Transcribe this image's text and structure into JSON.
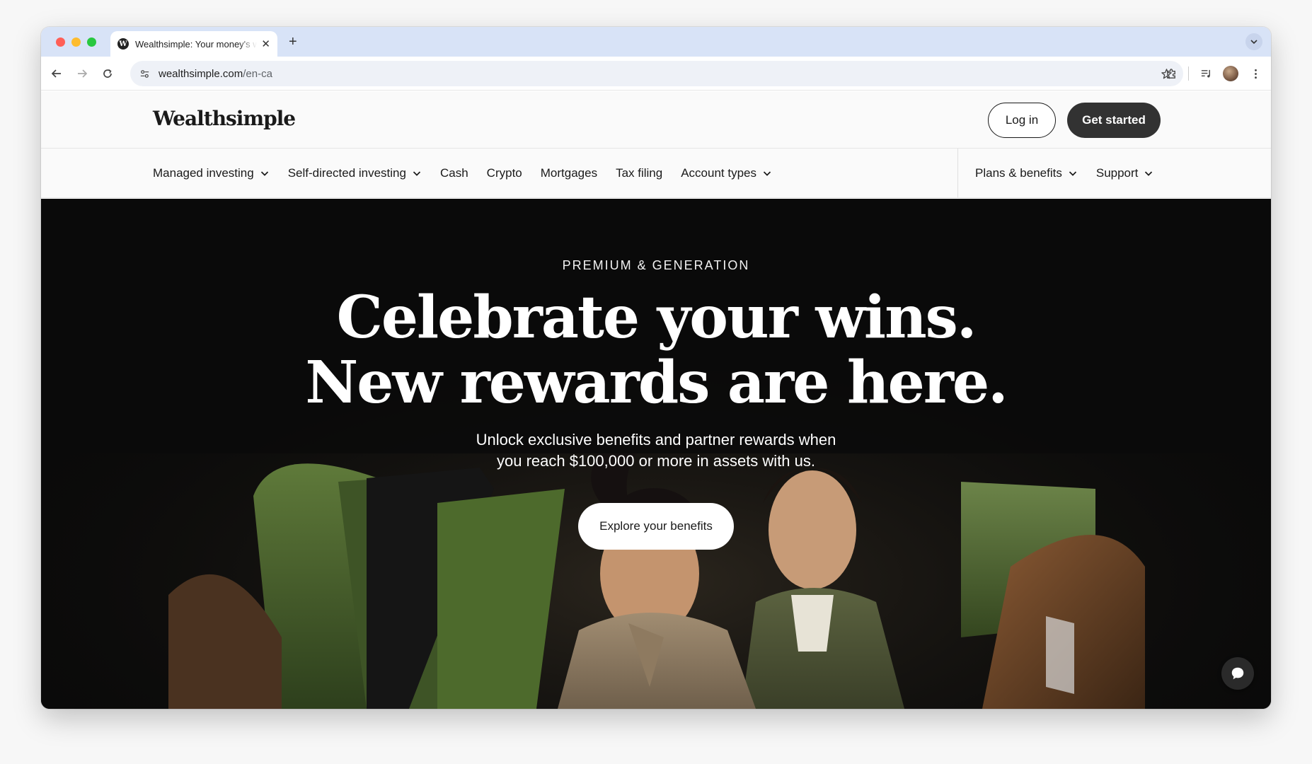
{
  "browser": {
    "tab_title": "Wealthsimple: Your money's working for you",
    "tab_favicon_letter": "W",
    "new_tab_symbol": "+",
    "close_symbol": "✕",
    "url_host": "wealthsimple.com",
    "url_path": "/en-ca"
  },
  "header": {
    "logo": "Wealthsimple",
    "login_label": "Log in",
    "get_started_label": "Get started"
  },
  "nav": {
    "left_items": [
      {
        "label": "Managed investing",
        "dropdown": true
      },
      {
        "label": "Self-directed investing",
        "dropdown": true
      },
      {
        "label": "Cash",
        "dropdown": false
      },
      {
        "label": "Crypto",
        "dropdown": false
      },
      {
        "label": "Mortgages",
        "dropdown": false
      },
      {
        "label": "Tax filing",
        "dropdown": false
      },
      {
        "label": "Account types",
        "dropdown": true
      }
    ],
    "right_items": [
      {
        "label": "Plans & benefits",
        "dropdown": true
      },
      {
        "label": "Support",
        "dropdown": true
      }
    ]
  },
  "hero": {
    "eyebrow": "PREMIUM & GENERATION",
    "headline_line1": "Celebrate your wins.",
    "headline_line2": "New rewards are here.",
    "sub_line1": "Unlock exclusive benefits and partner rewards when",
    "sub_line2": "you reach $100,000 or more in assets with us.",
    "cta_label": "Explore your benefits"
  },
  "colors": {
    "tab_strip": "#d8e3f7",
    "hero_background": "#0b0b0b",
    "primary_button": "#323232"
  }
}
